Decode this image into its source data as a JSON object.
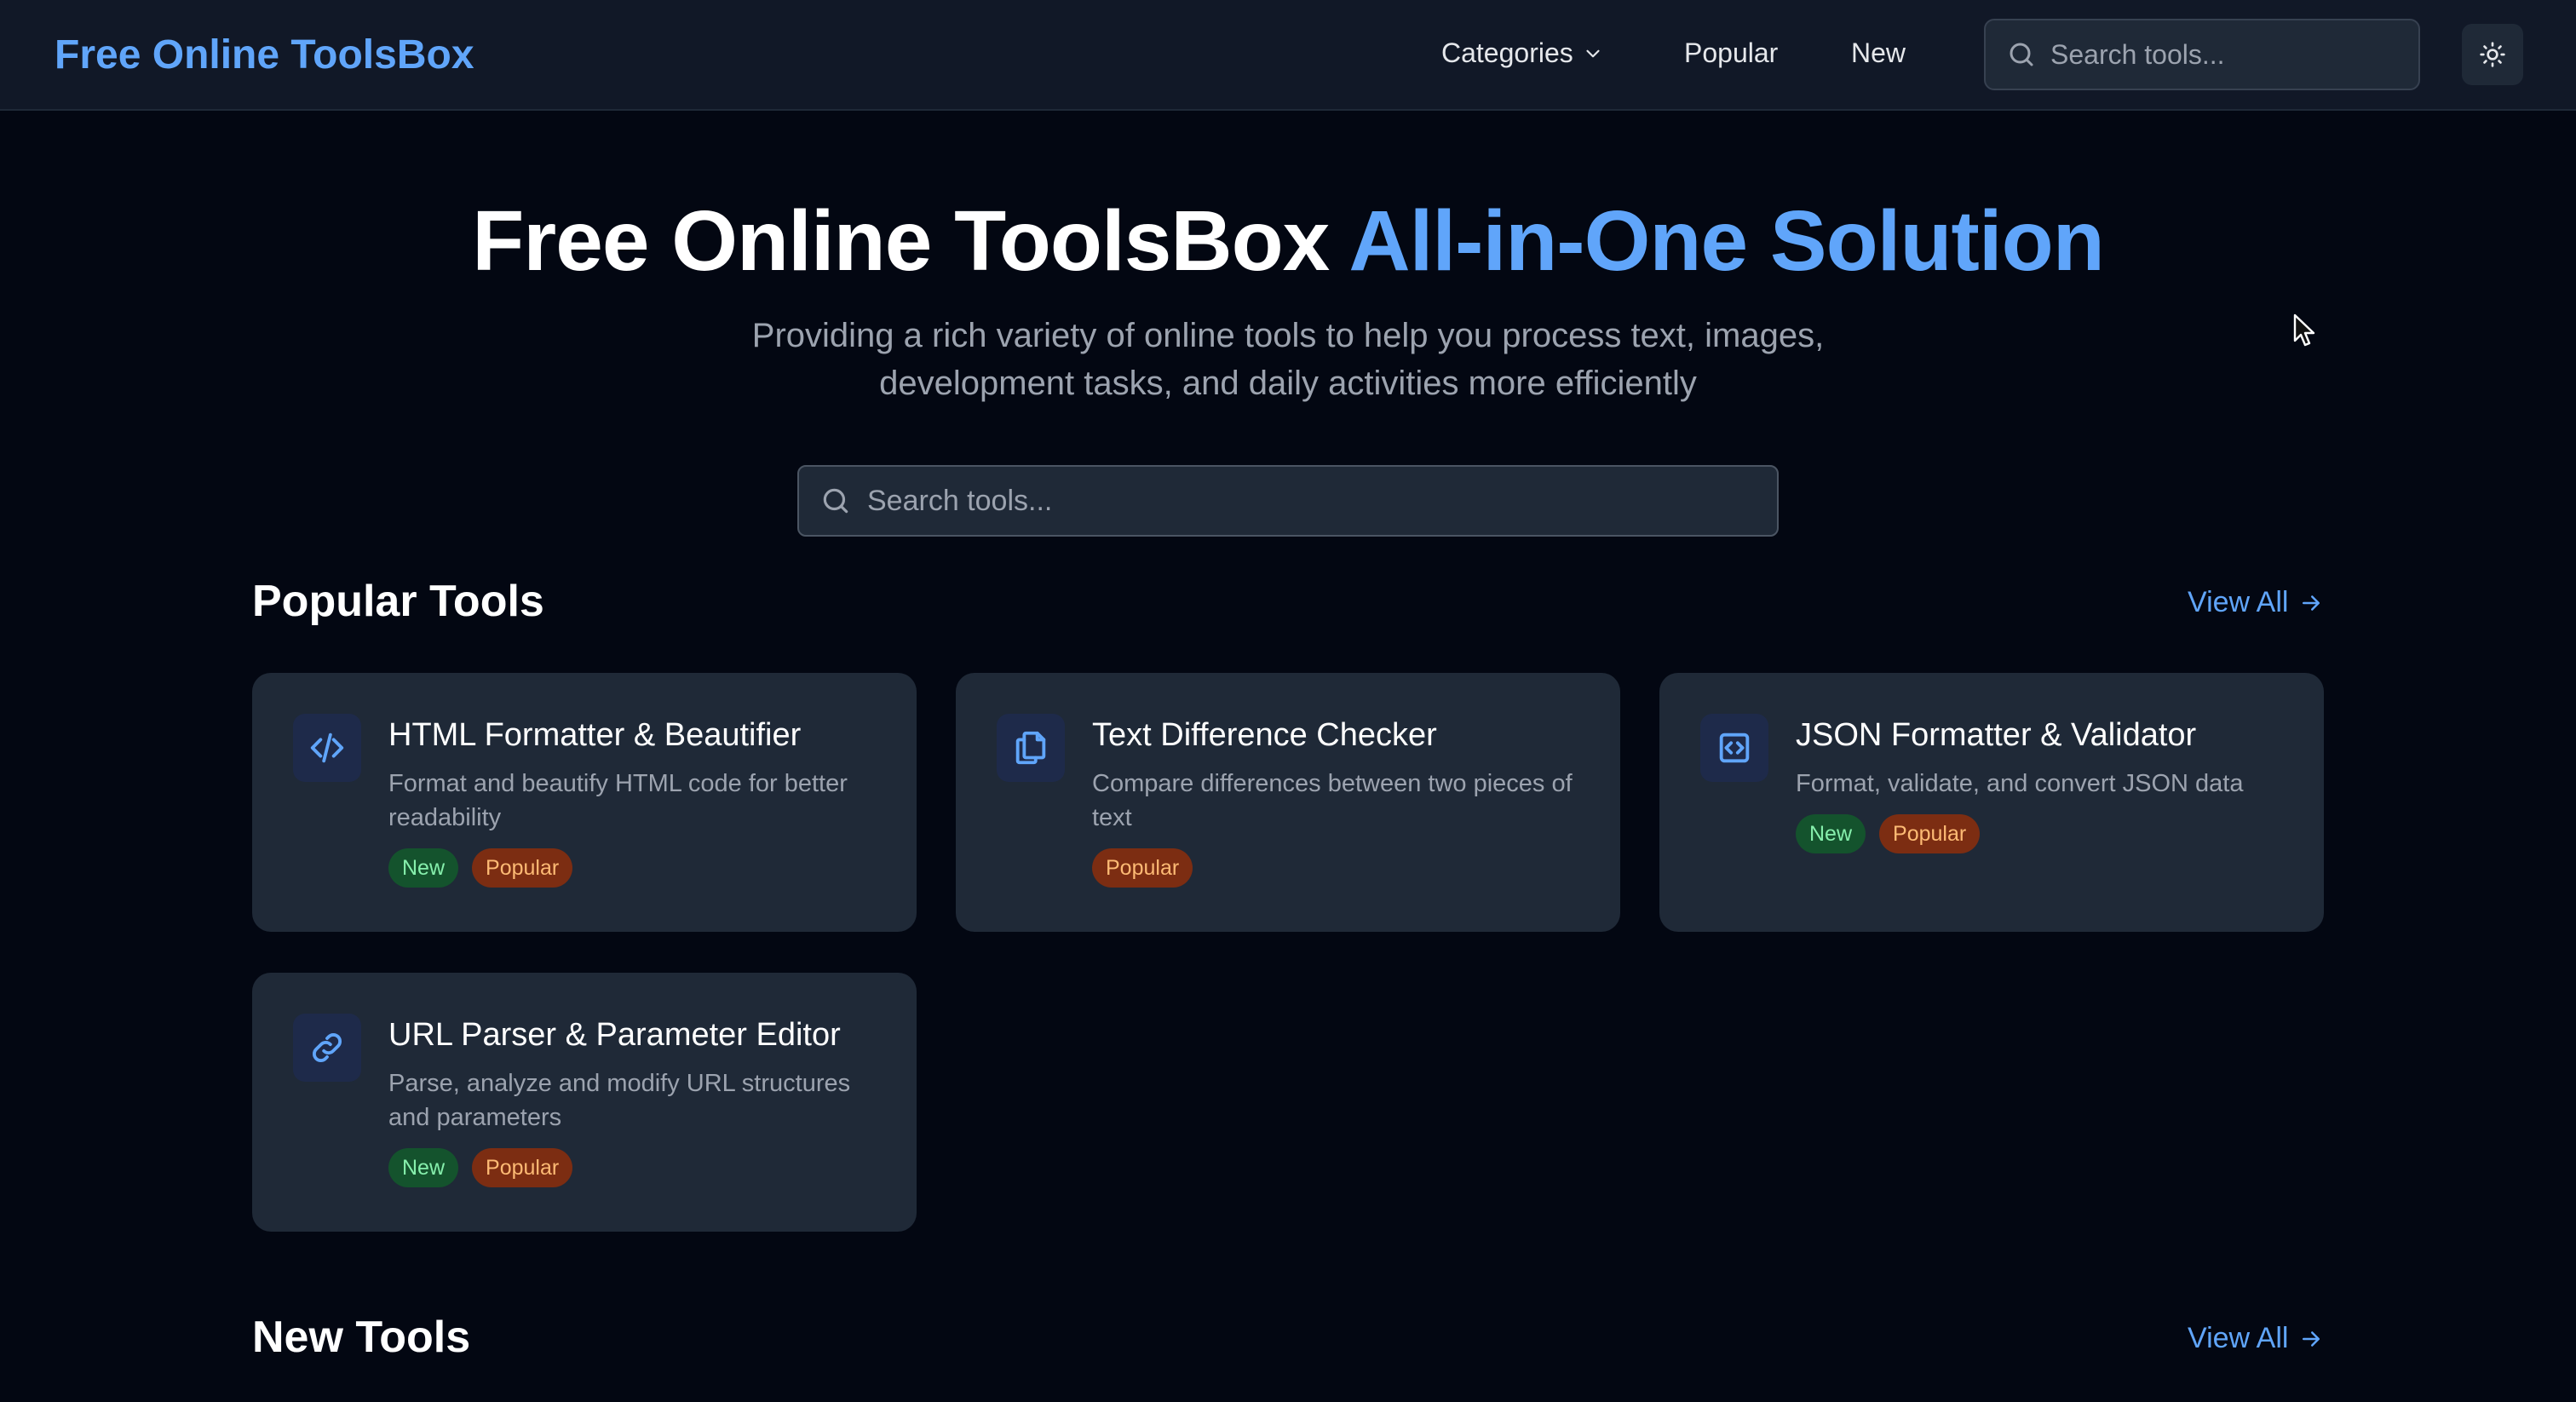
{
  "header": {
    "logo": "Free Online ToolsBox",
    "nav": {
      "categories": "Categories",
      "popular": "Popular",
      "new": "New"
    },
    "search_placeholder": "Search tools..."
  },
  "hero": {
    "title_main": "Free Online ToolsBox",
    "title_accent": "All-in-One Solution",
    "subtitle_line1": "Providing a rich variety of online tools to help you process text, images,",
    "subtitle_line2": "development tasks, and daily activities more efficiently",
    "search_placeholder": "Search tools..."
  },
  "popular_section": {
    "title": "Popular Tools",
    "view_all": "View All"
  },
  "new_section": {
    "title": "New Tools",
    "view_all": "View All"
  },
  "tools": [
    {
      "title": "HTML Formatter & Beautifier",
      "description": "Format and beautify HTML code for better readability",
      "icon": "code-icon",
      "badges": [
        "New",
        "Popular"
      ]
    },
    {
      "title": "Text Difference Checker",
      "description": "Compare differences between two pieces of text",
      "icon": "copy-icon",
      "badges": [
        "Popular"
      ]
    },
    {
      "title": "JSON Formatter & Validator",
      "description": "Format, validate, and convert JSON data",
      "icon": "code-square-icon",
      "badges": [
        "New",
        "Popular"
      ]
    },
    {
      "title": "URL Parser & Parameter Editor",
      "description": "Parse, analyze and modify URL structures and parameters",
      "icon": "link-icon",
      "badges": [
        "New",
        "Popular"
      ]
    }
  ],
  "colors": {
    "background": "#030712",
    "header": "#111827",
    "card": "#1f2937",
    "accent": "#60a5fa",
    "badge_new_bg": "#14532d",
    "badge_new_text": "#86efac",
    "badge_popular_bg": "#7c2d12",
    "badge_popular_text": "#fdba74"
  }
}
